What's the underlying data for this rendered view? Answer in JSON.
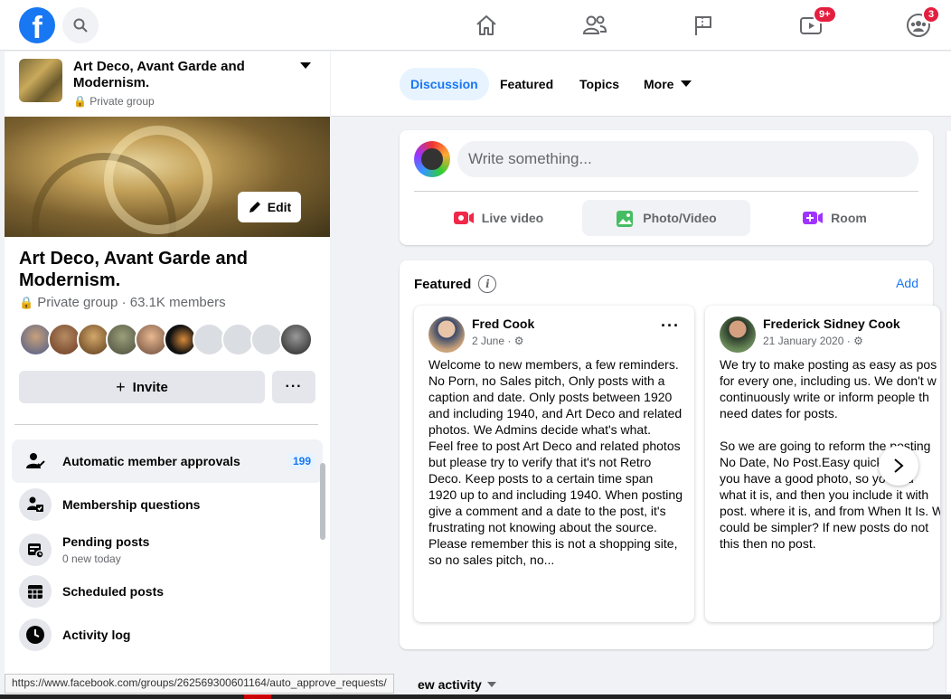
{
  "colors": {
    "brand": "#1877f2",
    "badge": "#e41e3f",
    "page_bg": "#f0f2f5"
  },
  "topbar": {
    "logo_letter": "f",
    "nav": [
      {
        "icon": "home-icon"
      },
      {
        "icon": "friends-icon"
      },
      {
        "icon": "pages-flag-icon"
      },
      {
        "icon": "watch-icon",
        "badge": "9+"
      },
      {
        "icon": "groups-icon",
        "badge": "3"
      }
    ]
  },
  "sidebar": {
    "group_name": "Art Deco, Avant Garde and Modernism.",
    "privacy": "Private group",
    "edit_label": "Edit",
    "meta": "Private group · 63.1K members",
    "invite_label": "Invite",
    "more_label": "···",
    "menu": [
      {
        "label": "Automatic member approvals",
        "count": "199",
        "icon": "member-approval-icon"
      },
      {
        "label": "Membership questions",
        "icon": "membership-questions-icon"
      },
      {
        "label": "Pending posts",
        "sub": "0 new today",
        "icon": "pending-posts-icon"
      },
      {
        "label": "Scheduled posts",
        "icon": "scheduled-posts-icon"
      },
      {
        "label": "Activity log",
        "icon": "activity-log-icon"
      }
    ]
  },
  "tabs": [
    {
      "label": "Discussion",
      "active": true
    },
    {
      "label": "Featured"
    },
    {
      "label": "Topics"
    },
    {
      "label": "More"
    }
  ],
  "composer": {
    "placeholder": "Write something...",
    "actions": [
      {
        "label": "Live video",
        "color": "#f02849"
      },
      {
        "label": "Photo/Video",
        "color": "#45bd62"
      },
      {
        "label": "Room",
        "color": "#a033ff"
      }
    ]
  },
  "featured": {
    "title": "Featured",
    "info_glyph": "i",
    "add_label": "Add",
    "posts": [
      {
        "author": "Fred Cook",
        "date": "2 June · ",
        "body": "Welcome to new members, a few reminders. No Porn, no Sales pitch, Only posts with a caption and date. Only posts between 1920 and including 1940, and Art Deco and related photos. We Admins decide what's what.\nFeel free to post Art Deco and related photos but please try to verify that it's not Retro Deco. Keep posts to a certain time span 1920 up to and including 1940. When posting give a comment and a date to the post, it's frustrating not knowing about the source. Please remember this is not a shopping site, so no sales pitch, no..."
      },
      {
        "author": "Frederick Sidney Cook",
        "date": "21 January 2020 · ",
        "body": "We try to make posting as easy as pos\nfor every one, including us. We don't w\ncontinuously write or inform people th\nneed dates for posts.\n\nSo we are going to reform the posting\nNo Date, No Post.Easy quick   nple\nyou have a good photo, so yo    d ou\nwhat it is, and then you include it with\npost. where it is, and from When It Is. W\ncould be simpler? If new posts do not\nthis then no post."
      }
    ]
  },
  "new_activity_label": "ew activity",
  "status_url": "https://www.facebook.com/groups/262569300601164/auto_approve_requests/"
}
